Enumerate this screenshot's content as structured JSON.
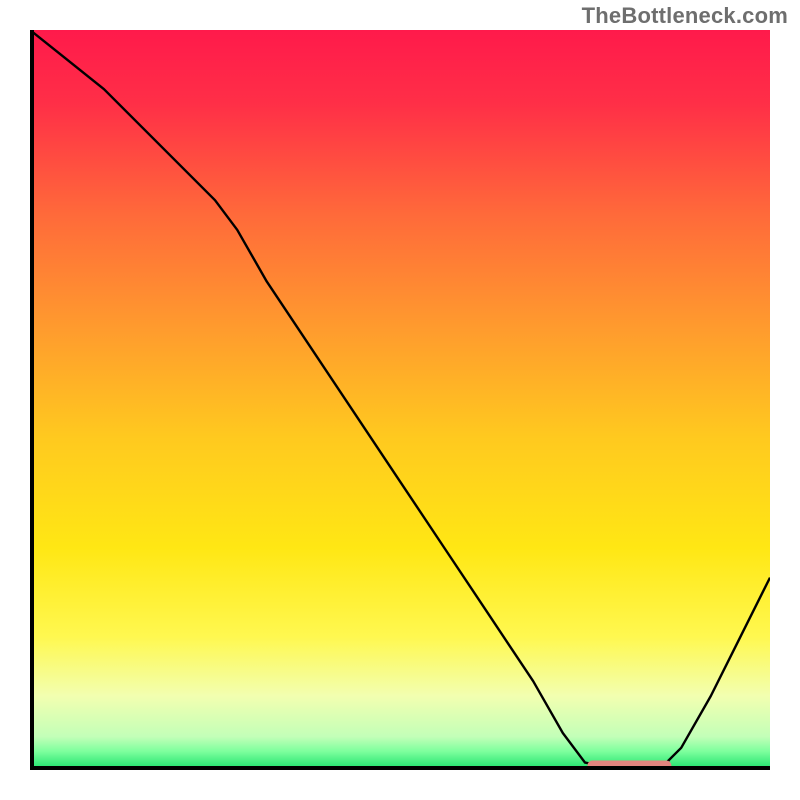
{
  "watermark": "TheBottleneck.com",
  "chart_data": {
    "type": "line",
    "title": "",
    "xlabel": "",
    "ylabel": "",
    "xlim": [
      0,
      100
    ],
    "ylim": [
      0,
      100
    ],
    "grid": false,
    "legend": false,
    "background": {
      "type": "vertical-gradient",
      "description": "Smooth red→orange→yellow→pale-green gradient with a thin saturated green band at the very bottom, representing bottleneck severity (red = bad, green = optimal).",
      "stops": [
        {
          "offset": 0.0,
          "color": "#ff1a4b"
        },
        {
          "offset": 0.1,
          "color": "#ff2f47"
        },
        {
          "offset": 0.25,
          "color": "#ff6a3a"
        },
        {
          "offset": 0.4,
          "color": "#ff9a2e"
        },
        {
          "offset": 0.55,
          "color": "#ffc91f"
        },
        {
          "offset": 0.7,
          "color": "#ffe714"
        },
        {
          "offset": 0.82,
          "color": "#fff850"
        },
        {
          "offset": 0.9,
          "color": "#f2ffb0"
        },
        {
          "offset": 0.955,
          "color": "#c3ffb8"
        },
        {
          "offset": 0.975,
          "color": "#7dff9d"
        },
        {
          "offset": 1.0,
          "color": "#19e06a"
        }
      ]
    },
    "series": [
      {
        "name": "bottleneck-curve",
        "color": "#000000",
        "stroke_width": 2.4,
        "x": [
          0,
          5,
          10,
          15,
          20,
          25,
          28,
          32,
          38,
          44,
          50,
          56,
          62,
          68,
          72,
          75,
          80,
          85,
          88,
          92,
          96,
          100
        ],
        "y": [
          100,
          96,
          92,
          87,
          82,
          77,
          73,
          66,
          57,
          48,
          39,
          30,
          21,
          12,
          5,
          1,
          0,
          0,
          3,
          10,
          18,
          26
        ]
      }
    ],
    "annotations": [
      {
        "type": "segment",
        "name": "optimal-range-marker",
        "color": "#e4857f",
        "stroke_width": 10,
        "linecap": "round",
        "x0": 76,
        "y0": 0.6,
        "x1": 86,
        "y1": 0.6
      }
    ],
    "frame": {
      "left": {
        "color": "#000000",
        "width": 8
      },
      "bottom": {
        "color": "#000000",
        "width": 8
      },
      "top": null,
      "right": null
    }
  }
}
